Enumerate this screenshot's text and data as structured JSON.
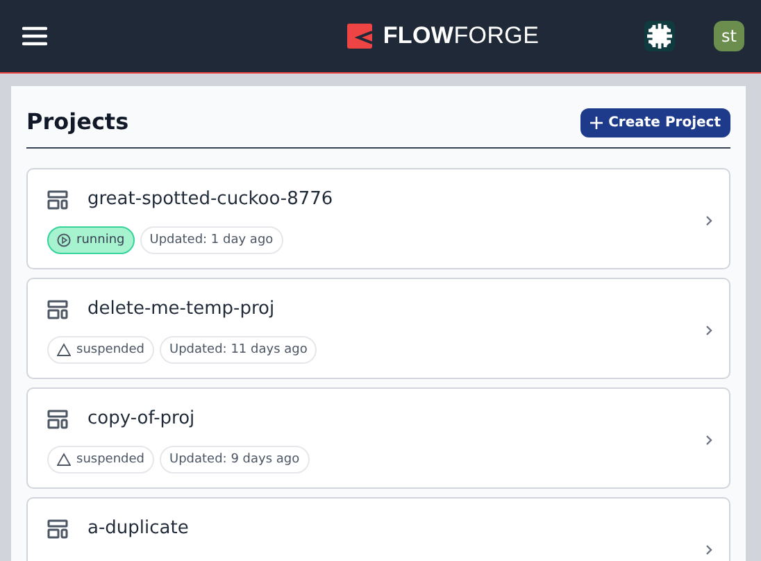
{
  "header": {
    "logo_text_bold": "FLOW",
    "logo_text": "FORGE",
    "avatar": "st"
  },
  "page": {
    "title": "Projects",
    "create_button": "Create Project"
  },
  "projects": [
    {
      "name": "great-spotted-cuckoo-8776",
      "status": {
        "kind": "running",
        "label": "running"
      },
      "updated": "Updated: 1 day ago"
    },
    {
      "name": "delete-me-temp-proj",
      "status": {
        "kind": "suspended",
        "label": "suspended"
      },
      "updated": "Updated: 11 days ago"
    },
    {
      "name": "copy-of-proj",
      "status": {
        "kind": "suspended",
        "label": "suspended"
      },
      "updated": "Updated: 9 days ago"
    },
    {
      "name": "a-duplicate"
    }
  ]
}
